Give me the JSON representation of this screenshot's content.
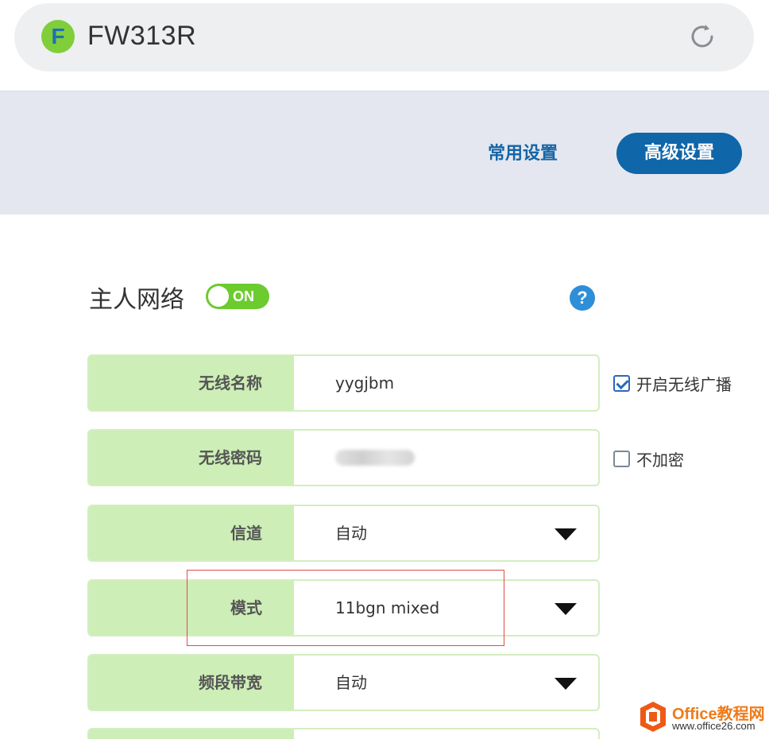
{
  "header": {
    "logo_letter": "F",
    "device_name": "FW313R"
  },
  "tabs": {
    "common": "常用设置",
    "advanced": "高级设置"
  },
  "section": {
    "title": "主人网络",
    "toggle_state": "ON",
    "help_symbol": "?"
  },
  "form": {
    "rows": [
      {
        "label": "无线名称",
        "value": "yygjbm"
      },
      {
        "label": "无线密码",
        "value": ""
      },
      {
        "label": "信道",
        "value": "自动"
      },
      {
        "label": "模式",
        "value": "11bgn mixed"
      },
      {
        "label": "频段带宽",
        "value": "自动"
      }
    ],
    "broadcast_checkbox": {
      "label": "开启无线广播",
      "checked": true
    },
    "no_encrypt_checkbox": {
      "label": "不加密",
      "checked": false
    }
  },
  "watermark": {
    "brand": "Office教程网",
    "url": "www.office26.com"
  },
  "colors": {
    "accent_blue": "#0f66a9",
    "toggle_green": "#6ccb2f",
    "label_bg": "#cdeeb6",
    "highlight_red": "#e24a4a"
  }
}
